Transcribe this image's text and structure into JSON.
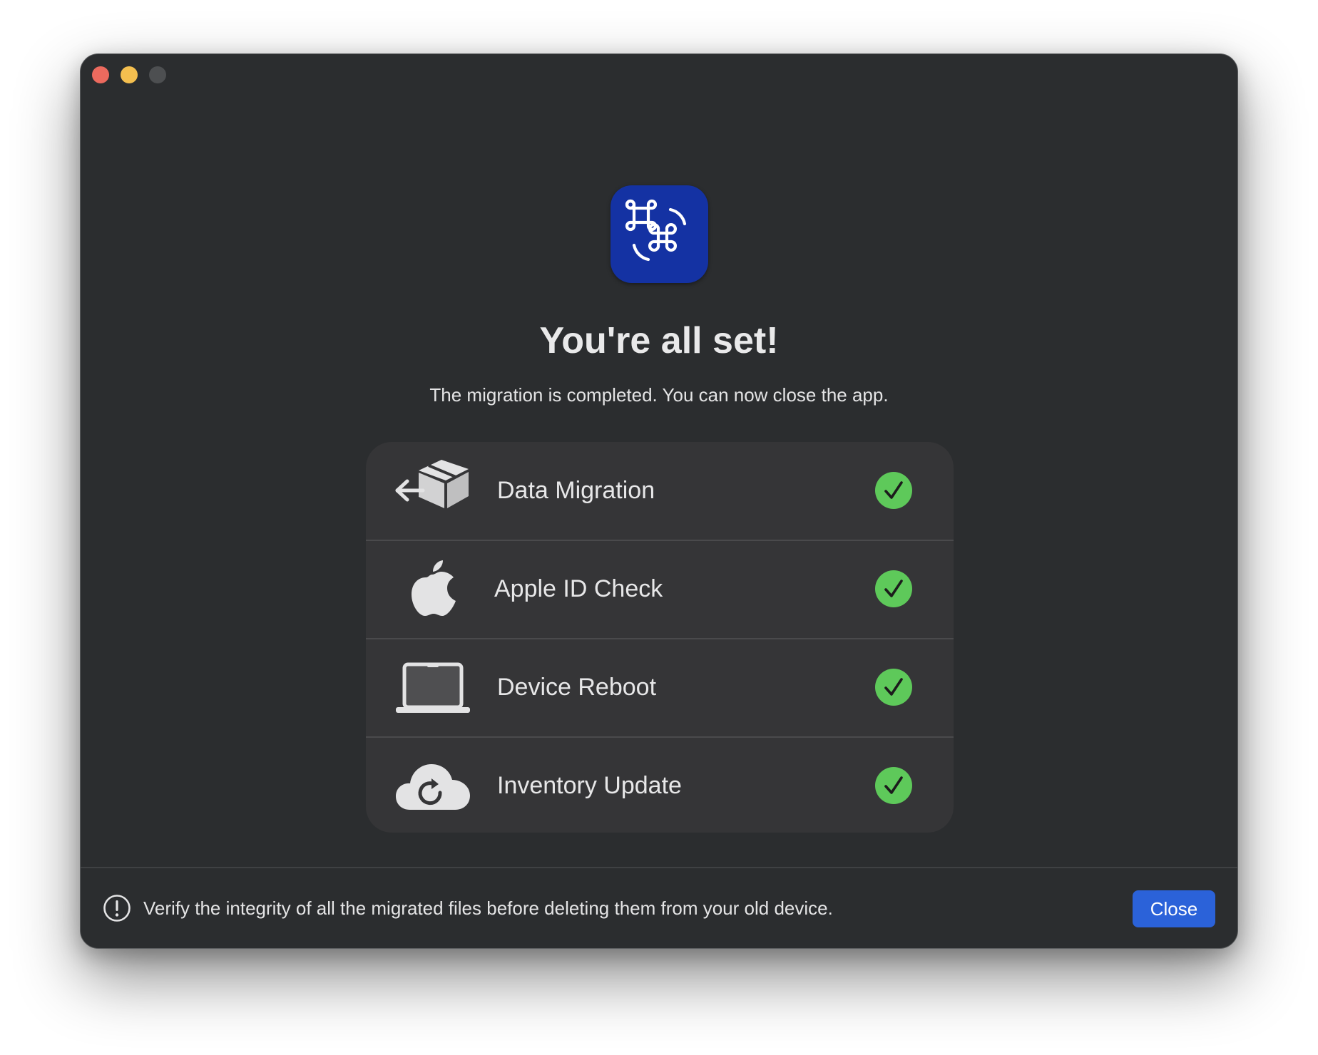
{
  "window": {
    "traffic_lights": [
      "close",
      "minimize",
      "zoom-disabled"
    ]
  },
  "app_icon": {
    "name": "command-key-icon",
    "background": "#1432a3"
  },
  "heading": "You're all set!",
  "subheading": "The migration is completed. You can now close the app.",
  "steps": [
    {
      "label": "Data Migration",
      "icon": "box-transfer-icon",
      "status": "complete"
    },
    {
      "label": "Apple ID Check",
      "icon": "apple-logo-icon",
      "status": "complete"
    },
    {
      "label": "Device Reboot",
      "icon": "laptop-icon",
      "status": "complete"
    },
    {
      "label": "Inventory Update",
      "icon": "cloud-sync-icon",
      "status": "complete"
    }
  ],
  "footer": {
    "notice": "Verify the integrity of all the migrated files before deleting them from your old device.",
    "notice_icon": "exclamation-circle-icon",
    "close_label": "Close"
  },
  "colors": {
    "window_bg": "#2b2d2f",
    "card_bg": "#353537",
    "check_green": "#5ec95a",
    "button_blue": "#2b62d9"
  }
}
